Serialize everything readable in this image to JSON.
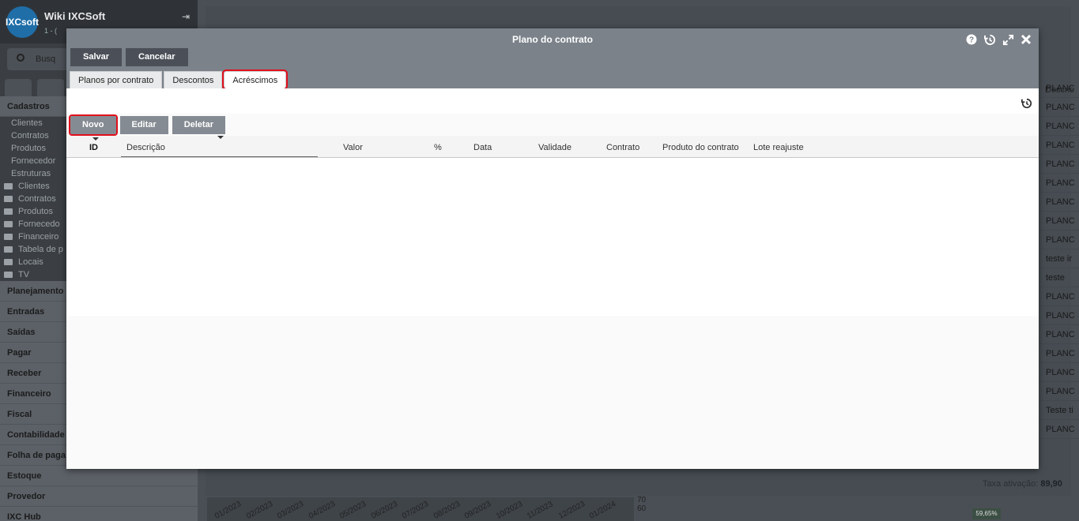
{
  "app": {
    "title": "Wiki IXCSoft",
    "subtitle": "1 - (",
    "logo_text": "IXCsoft",
    "search_placeholder": "Busq"
  },
  "sidebar": {
    "sections": [
      {
        "label": "Cadastros"
      },
      {
        "label": "Planejamento"
      },
      {
        "label": "Entradas"
      },
      {
        "label": "Saídas"
      },
      {
        "label": "Pagar"
      },
      {
        "label": "Receber"
      },
      {
        "label": "Financeiro"
      },
      {
        "label": "Fiscal"
      },
      {
        "label": "Contabilidade"
      },
      {
        "label": "Folha de paga"
      },
      {
        "label": "Estoque"
      },
      {
        "label": "Provedor"
      },
      {
        "label": "IXC Hub"
      }
    ],
    "cadastros_items": [
      "Clientes",
      "Contratos",
      "Produtos",
      "Fornecedor",
      "Estruturas"
    ],
    "folders": [
      "Clientes",
      "Contratos",
      "Produtos",
      "Fornecedo",
      "Financeiro",
      "Tabela de p",
      "Locais",
      "TV"
    ]
  },
  "background": {
    "list_header": "Descric",
    "list_items": [
      "PLANC",
      "PLANC",
      "PLANC",
      "PLANC",
      "PLANC",
      "PLANC",
      "PLANC",
      "PLANC",
      "PLANC",
      "teste ir",
      "teste",
      "PLANC",
      "PLANC",
      "PLANC",
      "PLANC",
      "PLANC",
      "PLANC",
      "Teste ti",
      "PLANC"
    ],
    "footer_label": "Taxa ativação:",
    "footer_value": "89,90",
    "dates": [
      "01/2023",
      "02/2023",
      "03/2023",
      "04/2023",
      "05/2023",
      "06/2023",
      "07/2023",
      "08/2023",
      "09/2023",
      "10/2023",
      "11/2023",
      "12/2023",
      "01/2024"
    ],
    "scale": [
      "70",
      "60"
    ],
    "percent": "59,65%"
  },
  "modal": {
    "title": "Plano do contrato",
    "save_label": "Salvar",
    "cancel_label": "Cancelar",
    "tabs": [
      {
        "label": "Planos por contrato"
      },
      {
        "label": "Descontos"
      },
      {
        "label": "Acréscimos"
      }
    ],
    "actions": {
      "new_label": "Novo",
      "edit_label": "Editar",
      "delete_label": "Deletar"
    },
    "columns": [
      "ID",
      "Descrição",
      "Valor",
      "%",
      "Data",
      "Validade",
      "Contrato",
      "Produto do contrato",
      "Lote reajuste"
    ]
  }
}
